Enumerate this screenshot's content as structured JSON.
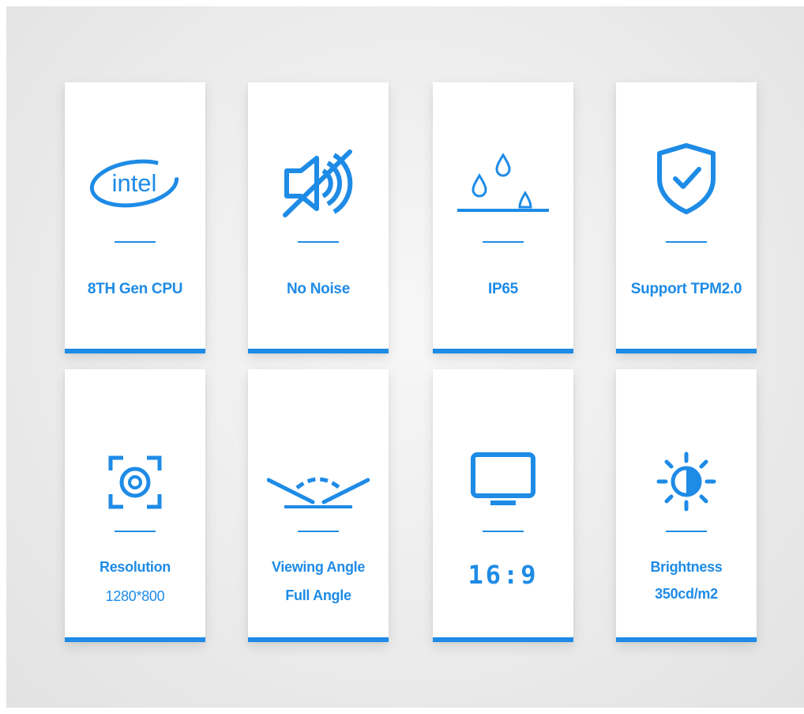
{
  "accent_color": "#1e8be6",
  "row1": [
    {
      "icon": "intel-logo-icon",
      "logo_text": "intel",
      "label": "8TH Gen CPU"
    },
    {
      "icon": "muted-speaker-icon",
      "label": "No Noise"
    },
    {
      "icon": "water-drops-icon",
      "label": "IP65"
    },
    {
      "icon": "shield-check-icon",
      "label": "Support TPM2.0"
    }
  ],
  "row2": [
    {
      "icon": "focus-lens-icon",
      "label": "Resolution",
      "sub": "1280*800"
    },
    {
      "icon": "viewing-angle-icon",
      "label": "Viewing Angle",
      "sub": "Full Angle"
    },
    {
      "icon": "monitor-icon",
      "big": "16:9"
    },
    {
      "icon": "brightness-sun-icon",
      "label": "Brightness",
      "sub": "350cd/m2"
    }
  ]
}
